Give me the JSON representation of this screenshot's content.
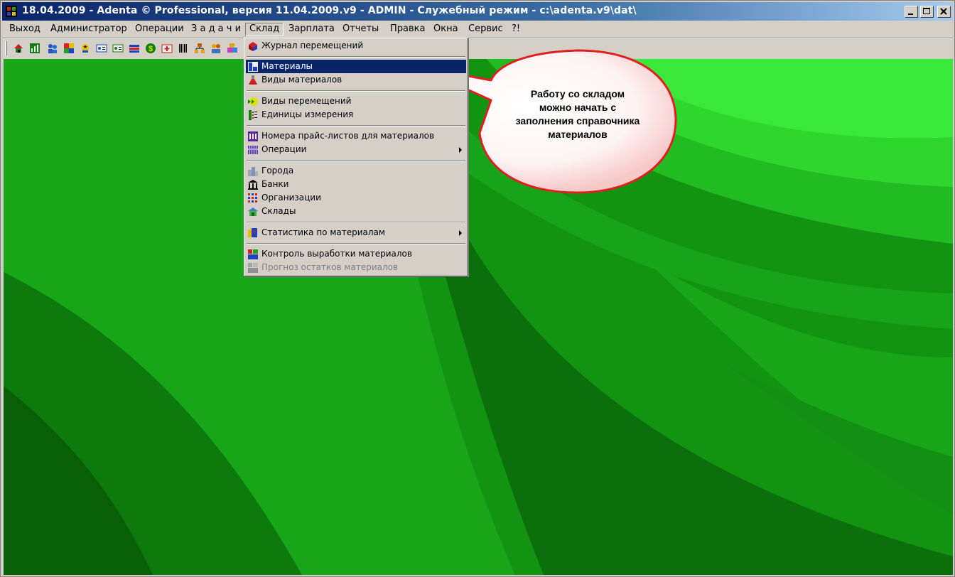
{
  "window": {
    "title": "18.04.2009 - Adenta © Professional, версия 11.04.2009.v9 - ADMIN - Служебный режим - c:\\adenta.v9\\dat\\",
    "controls": [
      "minimize-icon",
      "maximize-icon",
      "close-icon"
    ]
  },
  "menubar": {
    "items": [
      {
        "label": "Выход"
      },
      {
        "label": "Администратор"
      },
      {
        "label": "Операции"
      },
      {
        "label": "З а д а ч и"
      },
      {
        "label": "Склад"
      },
      {
        "label": "Зарплата"
      },
      {
        "label": "Отчеты"
      },
      {
        "label": "Правка"
      },
      {
        "label": "Окна"
      },
      {
        "label": "Сервис"
      },
      {
        "label": "?!"
      }
    ],
    "active": "Склад"
  },
  "toolbar": {
    "buttons": [
      "house-icon",
      "chart-icon",
      "people-icon",
      "puzzle-icon",
      "user-card-icon",
      "id-card-icon",
      "id-card-2-icon",
      "flags-icon",
      "dollar-icon",
      "first-aid-icon",
      "barcode-icon",
      "hierarchy-icon",
      "group-icon",
      "cubes-icon"
    ]
  },
  "dropdown": {
    "items": [
      {
        "label": "Журнал перемещений",
        "icon": "journal-icon"
      },
      {
        "label": "Материалы",
        "icon": "materials-icon",
        "selected": true
      },
      {
        "label": "Виды материалов",
        "icon": "flask-icon"
      },
      {
        "label": "Виды перемещений",
        "icon": "movement-icon"
      },
      {
        "label": "Единицы измерения",
        "icon": "units-icon"
      },
      {
        "label": "Номера прайс-листов для материалов",
        "icon": "price-list-icon"
      },
      {
        "label": "Операции",
        "icon": "operations-icon",
        "submenu": true
      },
      {
        "label": "Города",
        "icon": "city-icon"
      },
      {
        "label": "Банки",
        "icon": "bank-icon"
      },
      {
        "label": "Организации",
        "icon": "organization-icon"
      },
      {
        "label": "Склады",
        "icon": "warehouse-icon"
      },
      {
        "label": "Статистика по материалам",
        "icon": "statistics-icon",
        "submenu": true
      },
      {
        "label": "Контроль выработки материалов",
        "icon": "control-icon"
      },
      {
        "label": "Прогноз остатков материалов",
        "icon": "forecast-icon",
        "disabled": true
      }
    ]
  },
  "callout": {
    "text": "Работу со складом можно начать с заполнения справочника материалов"
  },
  "colors": {
    "titlebar_start": "#0a246a",
    "titlebar_end": "#a6caf0",
    "menu_face": "#d4d0c8",
    "selection": "#0a246a",
    "desktop_green": "#10a010",
    "callout_border": "#e02020"
  }
}
